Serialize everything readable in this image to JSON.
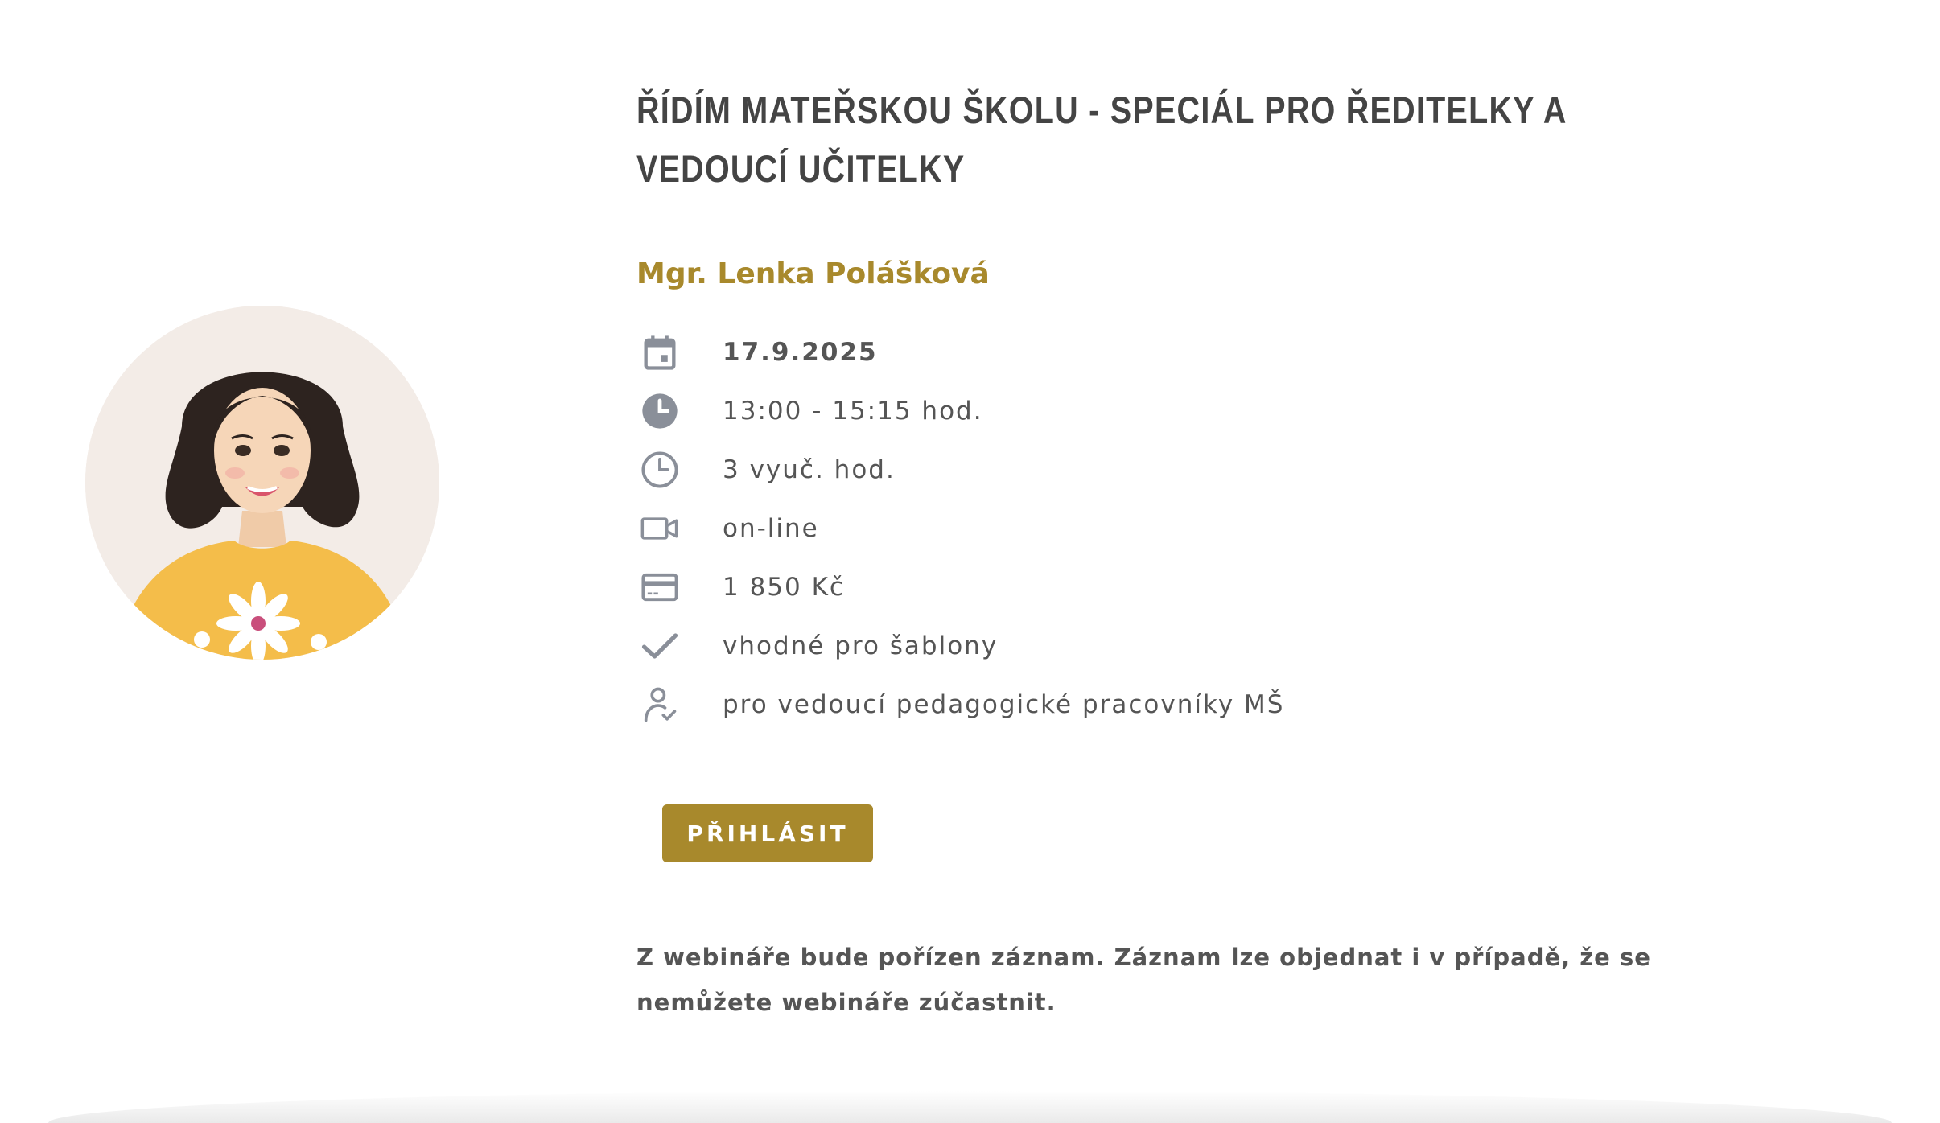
{
  "course": {
    "title": "ŘÍDÍM MATEŘSKOU ŠKOLU - SPECIÁL PRO ŘEDITELKY A VEDOUCÍ UČITELKY",
    "lecturer": "Mgr. Lenka Polášková"
  },
  "details": [
    {
      "icon": "calendar-icon",
      "text": "17.9.2025"
    },
    {
      "icon": "clock-filled-icon",
      "text": "13:00 - 15:15 hod."
    },
    {
      "icon": "clock-outline-icon",
      "text": "3 vyuč. hod."
    },
    {
      "icon": "video-camera-icon",
      "text": "on-line"
    },
    {
      "icon": "credit-card-icon",
      "text": "1 850 Kč"
    },
    {
      "icon": "checkmark-icon",
      "text": "vhodné pro šablony"
    },
    {
      "icon": "user-check-icon",
      "text": "pro vedoucí pedagogické pracovníky MŠ"
    }
  ],
  "register_button": "PŘIHLÁSIT",
  "note": "Z webináře bude pořízen záznam. Záznam lze objednat i v případě, že se nemůžete webináře zúčastnit.",
  "colors": {
    "accent": "#a8892c",
    "text": "#555555",
    "title": "#444444",
    "icon": "#8a8f99",
    "avatar_bg": "#f3ece7"
  }
}
